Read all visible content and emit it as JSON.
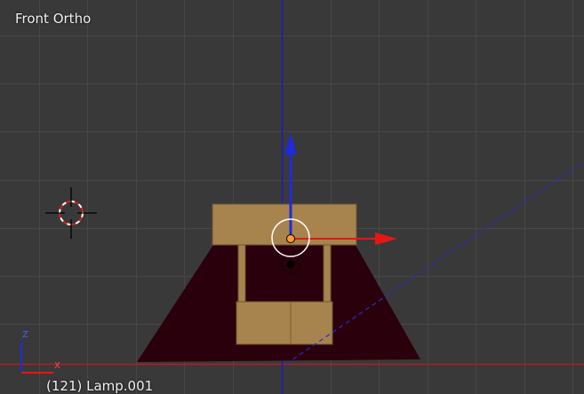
{
  "viewport": {
    "view_name": "Front Ortho",
    "object_info": "(121) Lamp.001",
    "background_color": "#393939",
    "grid_color": "#474747",
    "x_axis_color": "#b02020",
    "z_axis_color": "#1a1ac8"
  },
  "mini_axes": {
    "vertical_label": "Z",
    "horizontal_label": "X"
  },
  "manipulator": {
    "x_arrow_color": "#e81515",
    "z_arrow_color": "#1f2bd8",
    "center_dot_color": "#ff9a2e",
    "ring_color": "#ffffff"
  },
  "objects": {
    "lamp_light_color": "#2a000c",
    "lamp_body_color": "#a7844d",
    "icons": [
      "3d-cursor-icon",
      "lamp-origin-icon",
      "transform-manipulator-icon"
    ]
  }
}
